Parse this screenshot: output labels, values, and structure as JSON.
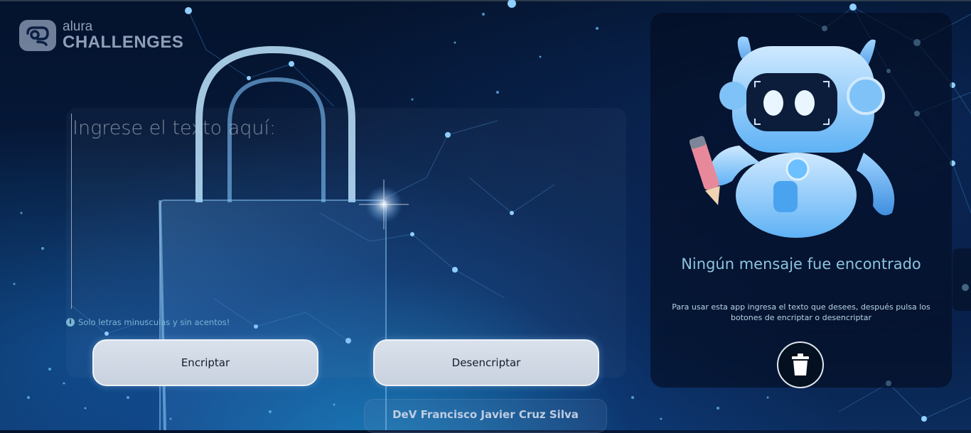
{
  "brand": {
    "line1": "alura",
    "line2": "CHALLENGES"
  },
  "input": {
    "placeholder": "Ingrese el texto aquí:",
    "hint": "Solo letras minusculas y sin acentos!"
  },
  "buttons": {
    "encrypt": "Encriptar",
    "decrypt": "Desencriptar"
  },
  "output": {
    "title": "Ningún mensaje fue encontrado",
    "description": "Para usar esta app ingresa el texto que desees, después pulsa los botones de encriptar o desencriptar"
  },
  "footer": {
    "credit": "DeV Francisco Javier Cruz Silva"
  },
  "icons": {
    "info": "info-icon",
    "trash": "trash-icon",
    "logo": "alura-logo-icon"
  },
  "colors": {
    "accent_text": "#8cc4e0",
    "button_bg": "#cfd8e4",
    "background": "#06193a"
  }
}
